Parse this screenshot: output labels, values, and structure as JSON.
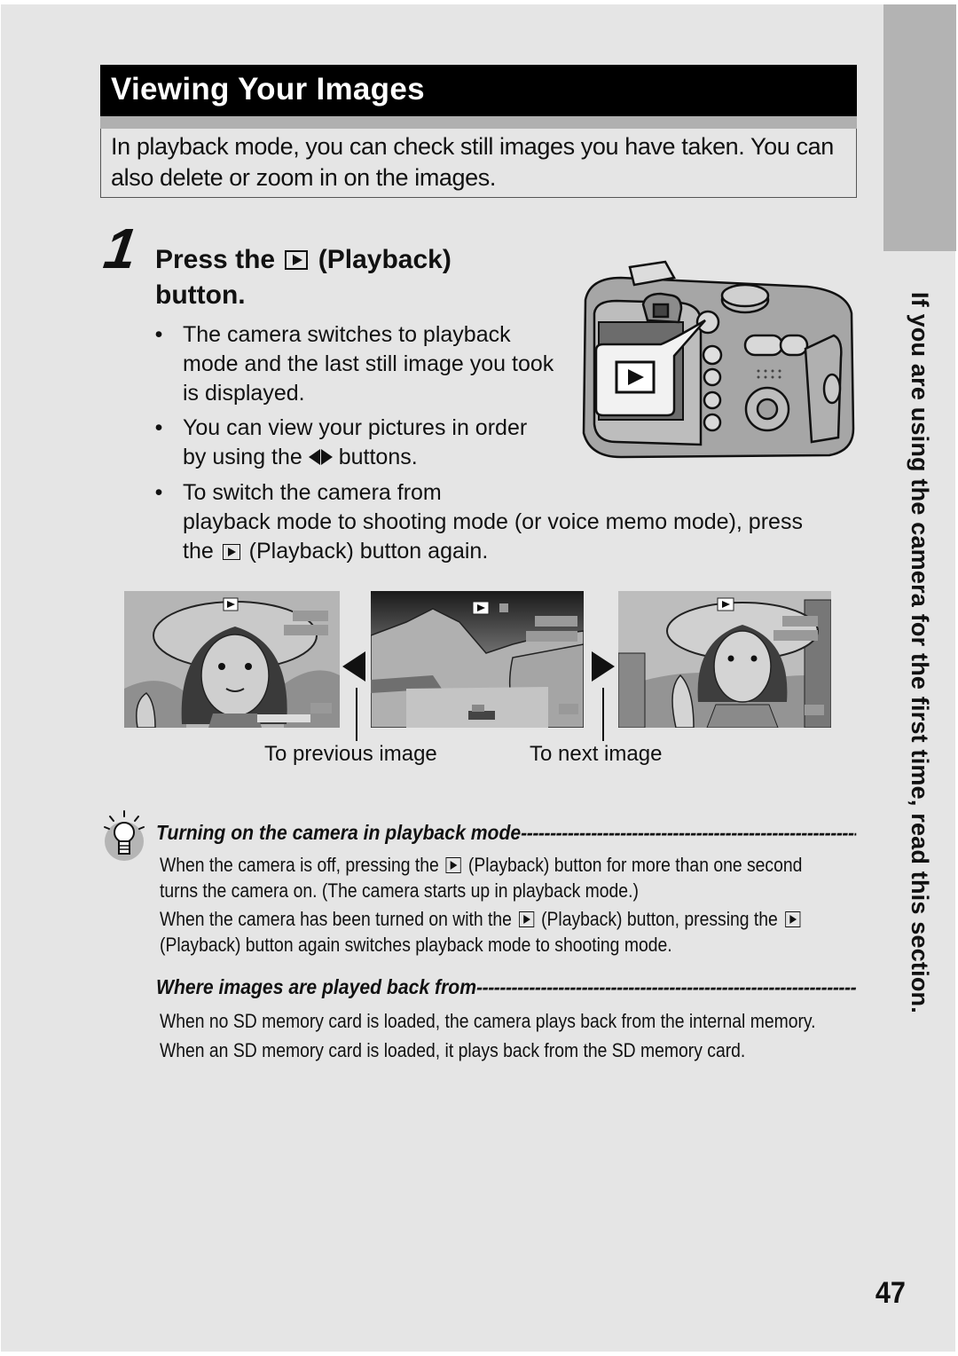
{
  "page": {
    "title": "Viewing Your Images",
    "intro": "In playback mode, you can check still images you have taken. You can also delete or zoom in on the images.",
    "side_tab_text": "If you are using the camera for the first time, read this section.",
    "page_number": "47"
  },
  "step": {
    "number": "1",
    "heading_before": "Press the",
    "heading_after": "(Playback)",
    "heading_line2": "button.",
    "button_icon": "playback-icon",
    "bullets": [
      {
        "text": "The camera switches to playback mode and the last still image you took is displayed."
      },
      {
        "before": "You can view your pictures in order by using the",
        "icon": "left-right-arrows-icon",
        "after": "buttons."
      },
      {
        "line1": "To switch the camera from",
        "line2": "playback mode to shooting mode (or voice memo mode), press",
        "line3_before": "the",
        "icon": "playback-icon",
        "line3_after": "(Playback) button again."
      }
    ]
  },
  "illustration": {
    "camera_callout_icon": "playback-icon",
    "thumbnails": [
      {
        "subject": "woman-with-hat"
      },
      {
        "subject": "mountain-lake-landscape"
      },
      {
        "subject": "woman-with-hat-waving"
      }
    ],
    "prev_caption": "To previous image",
    "next_caption": "To next image"
  },
  "notes": [
    {
      "icon": "lightbulb-hint-icon",
      "title": "Turning on the camera in playback mode",
      "lines": [
        {
          "before": "When the camera is off, pressing the",
          "icon": "playback-icon",
          "after": "(Playback) button for more than one second"
        },
        {
          "text": "turns the camera on. (The camera starts up in playback mode.)"
        },
        {
          "before": "When the camera has been turned on with the",
          "icon": "playback-icon",
          "after": "(Playback) button, pressing the",
          "icon2": "playback-icon"
        },
        {
          "text": "(Playback) button again switches playback mode to shooting mode."
        }
      ]
    },
    {
      "title": "Where images are played back from",
      "lines": [
        {
          "text": "When no SD memory card is loaded, the camera plays back from the internal memory."
        },
        {
          "text": "When an SD memory card is loaded, it plays back from the SD memory card."
        }
      ]
    }
  ],
  "colors": {
    "page_bg": "#e5e5e5",
    "title_bg": "#000000",
    "side_tab": "#b3b3b3",
    "text": "#111111"
  }
}
